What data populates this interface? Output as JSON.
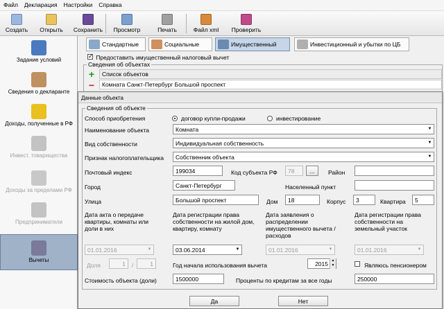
{
  "menu": [
    "Файл",
    "Декларация",
    "Настройки",
    "Справка"
  ],
  "toolbar": [
    {
      "label": "Создать",
      "icon": "new-document-icon",
      "color": "#9ab8e0"
    },
    {
      "label": "Открыть",
      "icon": "open-folder-icon",
      "color": "#e8c45a"
    },
    {
      "label": "Сохранить",
      "icon": "floppy-disk-icon",
      "color": "#6a4a9a"
    },
    {
      "label": "Просмотр",
      "icon": "preview-icon",
      "color": "#7aa0d0"
    },
    {
      "label": "Печать",
      "icon": "printer-icon",
      "color": "#a0a0a0"
    },
    {
      "label": "Файл xml",
      "icon": "xml-file-icon",
      "color": "#d88a3a"
    },
    {
      "label": "Проверить",
      "icon": "check-icon",
      "color": "#c04a8a"
    }
  ],
  "sidebar": [
    {
      "label": "Задание условий",
      "icon": "conditions-icon",
      "color": "#4a7ac0",
      "disabled": false,
      "active": false
    },
    {
      "label": "Сведения о декларанте",
      "icon": "person-icon",
      "color": "#c09060",
      "disabled": false,
      "active": false
    },
    {
      "label": "Доходы, полученные в РФ",
      "icon": "coins-icon",
      "color": "#e8c020",
      "disabled": false,
      "active": false
    },
    {
      "label": "Инвест. товарищества",
      "icon": "partnership-icon",
      "color": "#a0a0a0",
      "disabled": true,
      "active": false
    },
    {
      "label": "Доходы за пределами РФ",
      "icon": "money-bag-icon",
      "color": "#a8a8a8",
      "disabled": true,
      "active": false
    },
    {
      "label": "Предприниматели",
      "icon": "entrepreneur-icon",
      "color": "#a0a0a0",
      "disabled": true,
      "active": false
    },
    {
      "label": "Вычеты",
      "icon": "deductions-icon",
      "color": "#7a7a9a",
      "disabled": false,
      "active": true
    }
  ],
  "tabs": [
    {
      "label": "Стандартные",
      "icon": "standard-tab-icon",
      "color": "#8aa8c8",
      "selected": false
    },
    {
      "label": "Социальные",
      "icon": "social-tab-icon",
      "color": "#d09060",
      "selected": false
    },
    {
      "label": "Имущественный",
      "icon": "house-icon",
      "color": "#6a8ab0",
      "selected": true
    },
    {
      "label": "Инвестиционный и убытки по ЦБ",
      "icon": "investment-tab-icon",
      "color": "#b0b0b0",
      "selected": false
    }
  ],
  "property": {
    "checkbox_label": "Предоставить имущественный налоговый вычет",
    "objects_group": "Сведения об объектах",
    "list_header": "Список объектов",
    "list_items": [
      "Комната Санкт-Петербург  Большой проспект"
    ]
  },
  "dialog": {
    "title": "Данные объекта",
    "group": "Сведения об объекте",
    "acq_method_label": "Способ приобретения",
    "radio1": "договор купли-продажи",
    "radio2": "инвестирование",
    "object_name_label": "Наименование объекта",
    "object_name": "Комната",
    "ownership_label": "Вид собственности",
    "ownership": "Индивидуальная собственность",
    "taxpayer_label": "Признак налогоплательщика",
    "taxpayer": "Собственник объекта",
    "postal_label": "Почтовый индекс",
    "postal": "199034",
    "region_code_label": "Код субъекта РФ",
    "region_code": "78",
    "browse": "...",
    "district_label": "Район",
    "district": "",
    "city_label": "Город",
    "city": "Санкт-Петербург",
    "locality_label": "Населенный пункт",
    "locality": "",
    "street_label": "Улица",
    "street": "Большой проспект",
    "house_label": "Дом",
    "house": "18",
    "building_label": "Корпус",
    "building": "3",
    "apartment_label": "Квартира",
    "apartment": "5",
    "date1_label": "Дата акта о передаче квартиры, комнаты или доли в них",
    "date1": "01.01.2016",
    "date2_label": "Дата регистрации права собственности на жилой дом, квартиру, комнату",
    "date2": "03.06.2014",
    "date3_label": "Дата заявления о распределении имущественного вычета / расходов",
    "date3": "01.01.2016",
    "date4_label": "Дата регистрации права собственности на земельный участок",
    "date4": "01.01.2016",
    "share_label": "Доля",
    "share_num": "1",
    "share_sep": "/",
    "share_den": "1",
    "year_label": "Год начала использования вычета",
    "year": "2015",
    "pensioner_label": "Являюсь пенсионером",
    "cost_label": "Стоимость объекта (доли)",
    "cost": "1500000",
    "interest_label": "Проценты по кредитам за все годы",
    "interest": "250000",
    "ok": "Да",
    "cancel": "Нет"
  }
}
